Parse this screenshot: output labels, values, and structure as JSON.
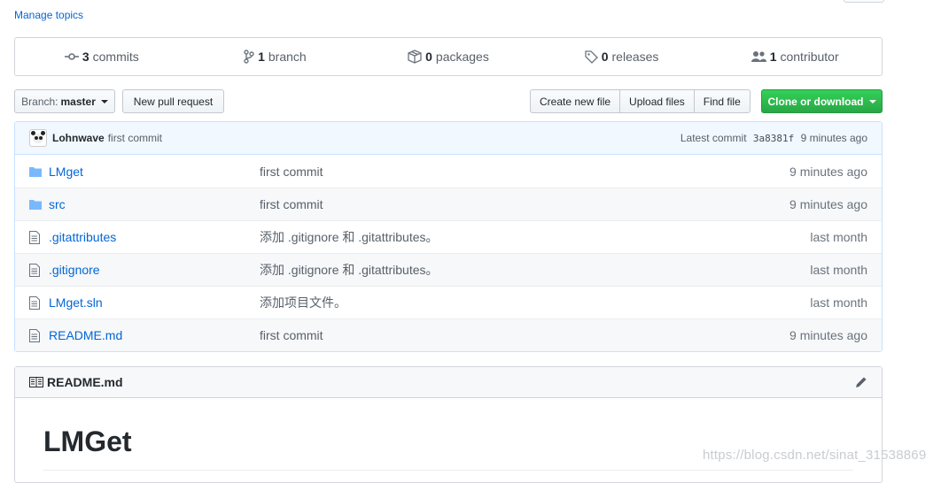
{
  "manage_topics": "Manage topics",
  "summary": {
    "commits": {
      "num": "3",
      "label": "commits"
    },
    "branches": {
      "num": "1",
      "label": "branch"
    },
    "packages": {
      "num": "0",
      "label": "packages"
    },
    "releases": {
      "num": "0",
      "label": "releases"
    },
    "contributors": {
      "num": "1",
      "label": "contributor"
    }
  },
  "toolbar": {
    "branch_prefix": "Branch:",
    "branch_name": "master",
    "new_pull_request": "New pull request",
    "create_new_file": "Create new file",
    "upload_files": "Upload files",
    "find_file": "Find file",
    "clone_or_download": "Clone or download"
  },
  "latest_commit": {
    "author": "Lohnwave",
    "message": "first commit",
    "prefix": "Latest commit",
    "sha": "3a8381f",
    "time": "9 minutes ago"
  },
  "files": [
    {
      "type": "folder",
      "name": "LMget",
      "message": "first commit",
      "age": "9 minutes ago"
    },
    {
      "type": "folder",
      "name": "src",
      "message": "first commit",
      "age": "9 minutes ago"
    },
    {
      "type": "file",
      "name": ".gitattributes",
      "message": "添加 .gitignore 和 .gitattributes。",
      "age": "last month"
    },
    {
      "type": "file",
      "name": ".gitignore",
      "message": "添加 .gitignore 和 .gitattributes。",
      "age": "last month"
    },
    {
      "type": "file",
      "name": "LMget.sln",
      "message": "添加项目文件。",
      "age": "last month"
    },
    {
      "type": "file",
      "name": "README.md",
      "message": "first commit",
      "age": "9 minutes ago"
    }
  ],
  "readme": {
    "filename": "README.md",
    "heading": "LMGet"
  },
  "watermark": "https://blog.csdn.net/sinat_31538869",
  "colors": {
    "link": "#0366d6",
    "green": "#28a745",
    "commit_bar": "#f1f8ff",
    "folder_icon": "#79b8ff"
  },
  "icons": [
    "commit-icon",
    "branch-icon",
    "package-icon",
    "tag-icon",
    "people-icon",
    "folder-icon",
    "file-icon",
    "book-icon",
    "pencil-icon"
  ]
}
